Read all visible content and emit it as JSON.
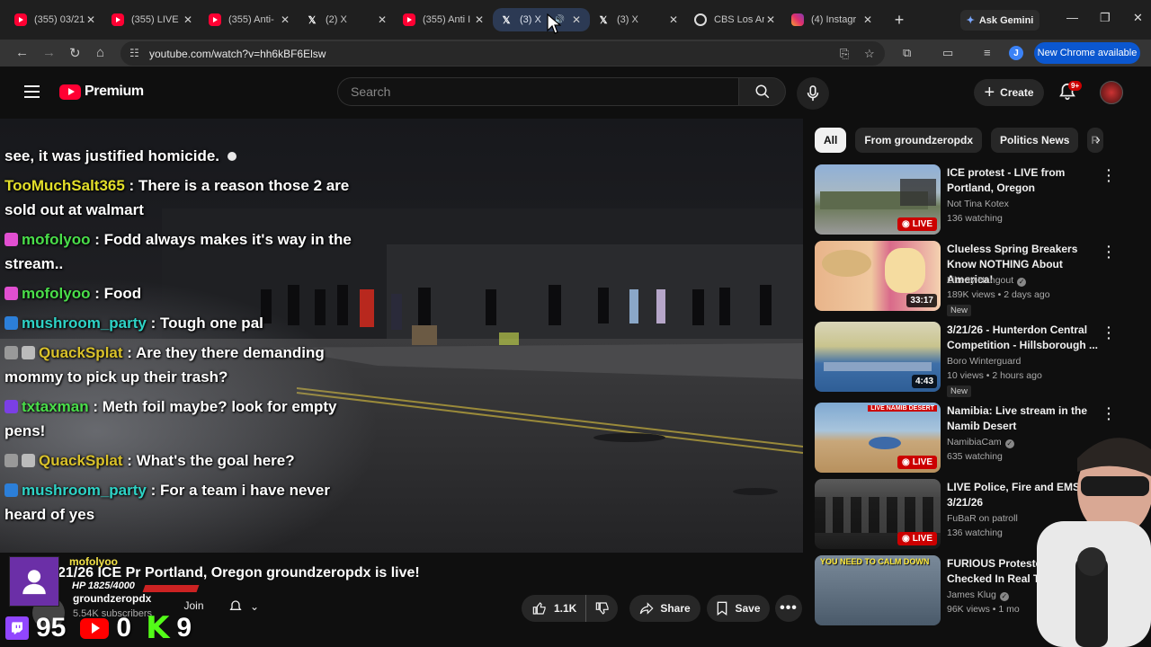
{
  "browser": {
    "tabs": [
      {
        "title": "(355) 03/21",
        "icon": "youtube-icon"
      },
      {
        "title": "(355) LIVE",
        "icon": "youtube-icon"
      },
      {
        "title": "(355) Anti-",
        "icon": "youtube-icon"
      },
      {
        "title": "(2) X",
        "icon": "x-icon"
      },
      {
        "title": "(355) Anti I",
        "icon": "youtube-icon"
      },
      {
        "title": "(3) X",
        "icon": "x-icon",
        "active": true
      },
      {
        "title": "(3) X",
        "icon": "x-icon"
      },
      {
        "title": "CBS Los An",
        "icon": "cbs-icon"
      },
      {
        "title": "(4) Instagr",
        "icon": "instagram-icon"
      }
    ],
    "ask_gemini": "Ask Gemini",
    "url": "youtube.com/watch?v=hh6kBF6Elsw",
    "profile_initial": "J",
    "update_label": "New Chrome available"
  },
  "youtube": {
    "brand": "Premium",
    "search_placeholder": "Search",
    "create_label": "Create",
    "notif_badge": "9+"
  },
  "video": {
    "chat": [
      {
        "user": "",
        "text": "see, it was justified homicide.",
        "badges": []
      },
      {
        "user": "TooMuchSalt365",
        "text": " : There is a reason those 2 are sold out at walmart",
        "color": "yellow",
        "badges": []
      },
      {
        "user": "mofolyoo",
        "text": " : Fodd always makes it's way in the stream..",
        "color": "green",
        "badges": [
          "pink"
        ]
      },
      {
        "user": "mofolyoo",
        "text": " : Food",
        "color": "green",
        "badges": [
          "pink"
        ]
      },
      {
        "user": "mushroom_party",
        "text": " : Tough one pal",
        "color": "cyan",
        "badges": [
          "blue"
        ]
      },
      {
        "user": "QuackSplat",
        "text": " : Are they there demanding mommy to pick up their trash?",
        "color": "gold",
        "badges": [
          "grey",
          "boxgrey"
        ]
      },
      {
        "user": "txtaxman",
        "text": " : Meth foil maybe? look for empty pens!",
        "color": "green",
        "badges": [
          "purple"
        ]
      },
      {
        "user": "QuackSplat",
        "text": " : What's the goal here?",
        "color": "gold",
        "badges": [
          "grey",
          "boxgrey"
        ]
      },
      {
        "user": "mushroom_party",
        "text": " : For a team i have never heard of yes",
        "color": "cyan",
        "badges": [
          "blue"
        ]
      }
    ],
    "title": "21/26 ICE Pr    Portland, Oregon groundzeropdx is live!",
    "overlay_user": "mofolyoo",
    "overlay_hp": "HP 1825/4000",
    "channel": "groundzeropdx",
    "subscribers": "5.54K subscribers",
    "join_label": "Join",
    "likes": "1.1K",
    "share_label": "Share",
    "save_label": "Save",
    "counter_twitch": "95",
    "counter_youtube": "0",
    "counter_kick": "9"
  },
  "sidebar": {
    "chips": [
      "All",
      "From groundzeropdx",
      "Politics News",
      "R"
    ],
    "recommendations": [
      {
        "title": "ICE protest - LIVE from Portland, Oregon",
        "channel": "Not Tina Kotex",
        "meta": "136 watching",
        "badge": "LIVE",
        "verified": false,
        "new": false
      },
      {
        "title": "Clueless Spring Breakers Know NOTHING About America!",
        "channel": "Liberty Hangout",
        "meta": "189K views • 2 days ago",
        "badge": "33:17",
        "verified": true,
        "new": true
      },
      {
        "title": "3/21/26 - Hunterdon Central Competition - Hillsborough ...",
        "channel": "Boro Winterguard",
        "meta": "10 views • 2 hours ago",
        "badge": "4:43",
        "verified": false,
        "new": true
      },
      {
        "title": "Namibia: Live stream in the Namib Desert",
        "channel": "NamibiaCam",
        "meta": "635 watching",
        "badge": "LIVE",
        "verified": true,
        "new": false
      },
      {
        "title": "LIVE Police, Fire and EMS 3/21/26",
        "channel": "FuBaR on patroll",
        "meta": "136 watching",
        "badge": "LIVE",
        "verified": false,
        "new": false
      },
      {
        "title": "FURIOUS Protesters Checked In Real T",
        "channel": "James Klug",
        "meta": "96K views • 1 mo",
        "badge": "",
        "verified": true,
        "new": false
      }
    ],
    "new_label": "New",
    "thumb4_label": "LIVE NAMIB DESERT",
    "thumb6_text": "YOU NEED TO CALM DOWN"
  }
}
